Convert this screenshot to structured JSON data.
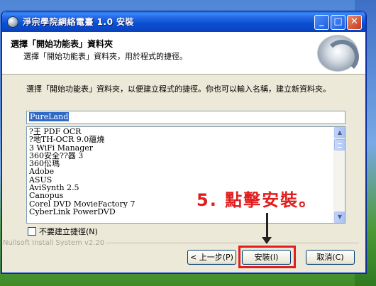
{
  "window": {
    "title": "淨宗學院網絡電臺 1.0 安裝"
  },
  "header": {
    "title": "選擇「開始功能表」資料夾",
    "subtitle": "選擇「開始功能表」資料夾，用於程式的捷徑。"
  },
  "description": "選擇「開始功能表」資料夾，以便建立程式的捷徑。你也可以輸入名稱，建立新資料夾。",
  "folder_input": {
    "value": "PureLand"
  },
  "folder_list": [
    "?王 PDF OCR",
    "?地TH-OCR 9.0蘊燒",
    "3 WiFi Manager",
    "360安全??器 3",
    "360伀瑪",
    "Adobe",
    "ASUS",
    "AviSynth 2.5",
    "Canopus",
    "Corel DVD MovieFactory 7",
    "CyberLink PowerDVD"
  ],
  "checkbox": {
    "label": "不要建立捷徑(N)",
    "checked": false
  },
  "footer": {
    "brand": "Nullsoft Install System v2.20"
  },
  "buttons": {
    "back": "< 上一步(P)",
    "install": "安裝(I)",
    "cancel": "取消(C)"
  },
  "annotation": {
    "text": "5. 點擊安裝。"
  },
  "colors": {
    "annotation": "#e01e1e",
    "titlebar": "#0a4fd2",
    "selection": "#316ac5"
  },
  "icons": {
    "window_icon": "setup-disc-icon",
    "minimize": "minimize-icon",
    "maximize": "maximize-icon",
    "close": "close-icon"
  }
}
